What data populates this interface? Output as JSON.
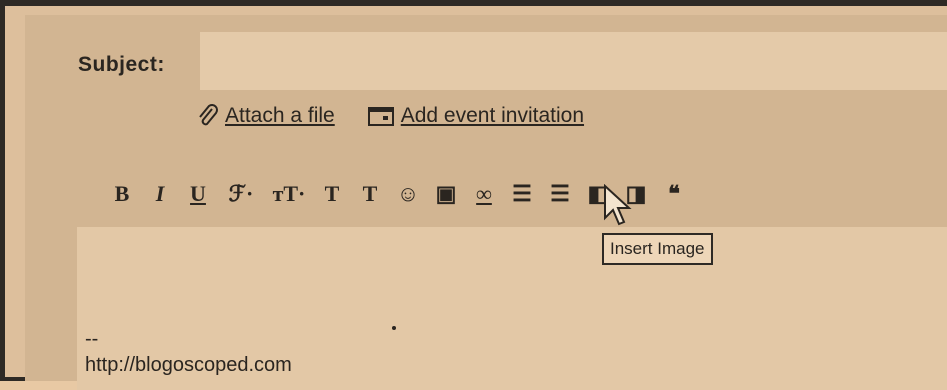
{
  "compose": {
    "subject_label": "Subject:",
    "subject_value": "",
    "attach_label": "Attach a file",
    "event_label": "Add event invitation",
    "toolbar": [
      {
        "name": "bold-button",
        "glyph": "B",
        "icon": "bold-icon"
      },
      {
        "name": "italic-button",
        "glyph": "I",
        "icon": "italic-icon"
      },
      {
        "name": "underline-button",
        "glyph": "U",
        "icon": "underline-icon"
      },
      {
        "name": "font-button",
        "glyph": "ℱ·",
        "icon": "font-icon"
      },
      {
        "name": "font-size-button",
        "glyph": "ᴛT·",
        "icon": "font-size-icon"
      },
      {
        "name": "text-color-button",
        "glyph": "T",
        "icon": "text-color-icon"
      },
      {
        "name": "remove-formatting-button",
        "glyph": "T",
        "icon": "remove-formatting-icon"
      },
      {
        "name": "emoticon-button",
        "glyph": "☺",
        "icon": "emoticon-icon"
      },
      {
        "name": "insert-image-button",
        "glyph": "▣",
        "icon": "image-icon"
      },
      {
        "name": "link-button",
        "glyph": "∞",
        "icon": "link-icon"
      },
      {
        "name": "numbered-list-button",
        "glyph": "☰",
        "icon": "numbered-list-icon"
      },
      {
        "name": "bulleted-list-button",
        "glyph": "☰",
        "icon": "bulleted-list-icon"
      },
      {
        "name": "outdent-button",
        "glyph": "◧",
        "icon": "outdent-icon"
      },
      {
        "name": "indent-button",
        "glyph": "◨",
        "icon": "indent-icon"
      },
      {
        "name": "quote-button",
        "glyph": "❝",
        "icon": "quote-icon"
      }
    ],
    "tooltip": "Insert Image",
    "signature_dashes": "--",
    "signature_url": "http://blogoscoped.com"
  }
}
